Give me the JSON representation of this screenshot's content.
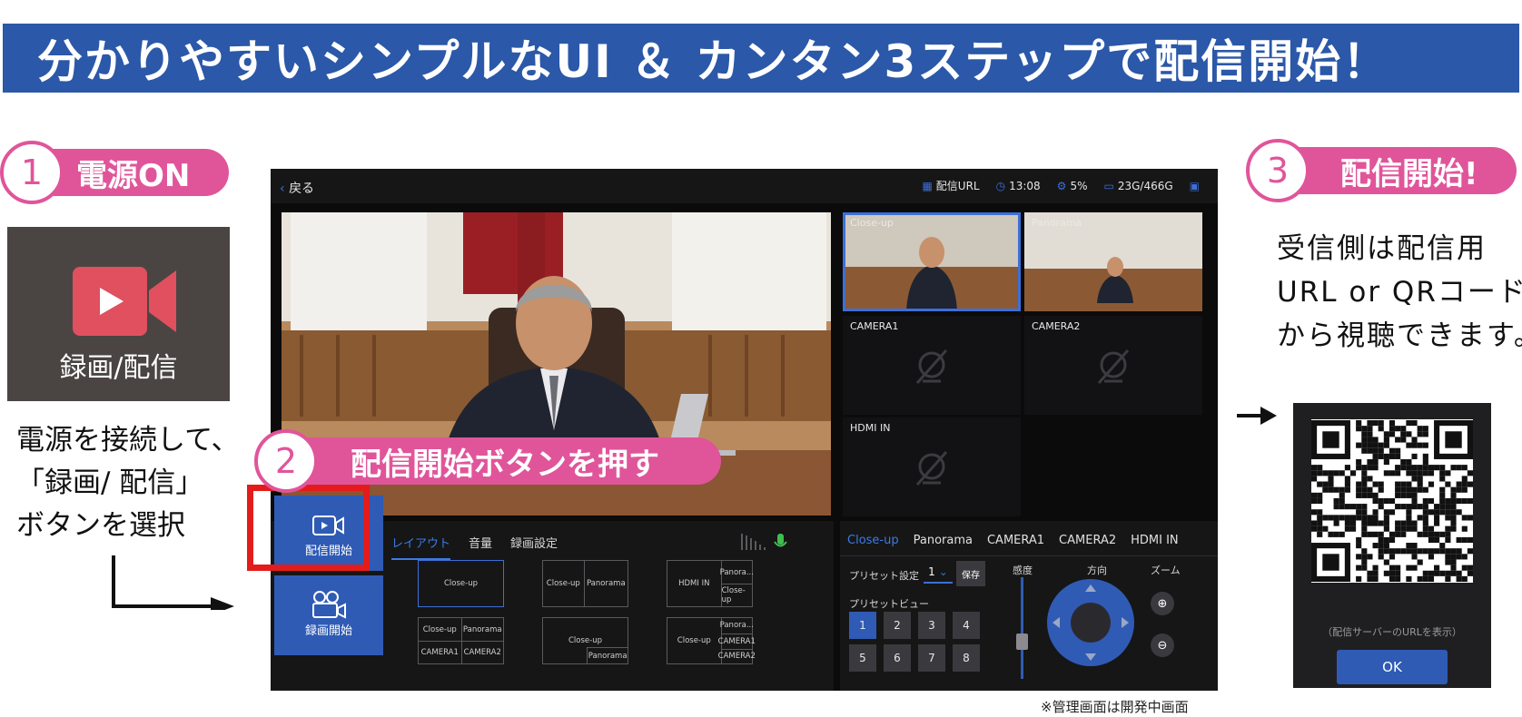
{
  "banner": {
    "title": "分かりやすいシンプルなUI ＆ カンタン3ステップで配信開始！"
  },
  "step1": {
    "number": "1",
    "label": "電源ON"
  },
  "step2": {
    "number": "2",
    "label": "配信開始ボタンを押す"
  },
  "step3": {
    "number": "3",
    "label": "配信開始!"
  },
  "device_button": {
    "label": "録画/配信",
    "icon": "video-camera-icon"
  },
  "left_text": "電源を接続して、\n「録画/ 配信」\nボタンを選択",
  "right_text": "受信側は配信用\nURL or QRコード\nから視聴できます。",
  "qr_panel": {
    "hint": "（配信サーバーのURLを表示）",
    "ok_label": "OK"
  },
  "footnote": "※管理画面は開発中画面",
  "app": {
    "back_label": "戻る",
    "status": {
      "url_label": "配信URL",
      "time": "13:08",
      "cpu": "5%",
      "storage": "23G/466G"
    },
    "thumbnails": [
      {
        "label": "Close-up",
        "state": "live",
        "selected": true
      },
      {
        "label": "Panorama",
        "state": "live",
        "selected": false
      },
      {
        "label": "CAMERA1",
        "state": "offline",
        "selected": false
      },
      {
        "label": "CAMERA2",
        "state": "offline",
        "selected": false
      },
      {
        "label": "HDMI IN",
        "state": "offline",
        "selected": false
      }
    ],
    "side_buttons": {
      "stream": "配信開始",
      "record": "録画開始"
    },
    "tabs": {
      "layout": "レイアウト",
      "volume": "音量",
      "record_settings": "録画設定"
    },
    "layouts": {
      "l1": "Close-up",
      "l2a": "Close-up",
      "l2b": "Panorama",
      "l3a": "HDMI IN",
      "l3b": "Panora...",
      "l3c": "Close-up",
      "l4a": "Close-up",
      "l4b": "Panorama",
      "l4c": "CAMERA1",
      "l4d": "CAMERA2",
      "l5a": "Close-up",
      "l5b": "Panorama",
      "l6a": "Close-up",
      "l6b": "Panora...",
      "l6c": "CAMERA1",
      "l6d": "CAMERA2"
    },
    "camera_tabs": [
      "Close-up",
      "Panorama",
      "CAMERA1",
      "CAMERA2",
      "HDMI IN"
    ],
    "preset": {
      "label": "プリセット設定",
      "value": "1",
      "save_label": "保存",
      "view_label": "プリセットビュー",
      "buttons": [
        "1",
        "2",
        "3",
        "4",
        "5",
        "6",
        "7",
        "8"
      ],
      "selected": "1"
    },
    "controls": {
      "sensitivity": "感度",
      "direction": "方向",
      "zoom": "ズーム"
    }
  }
}
